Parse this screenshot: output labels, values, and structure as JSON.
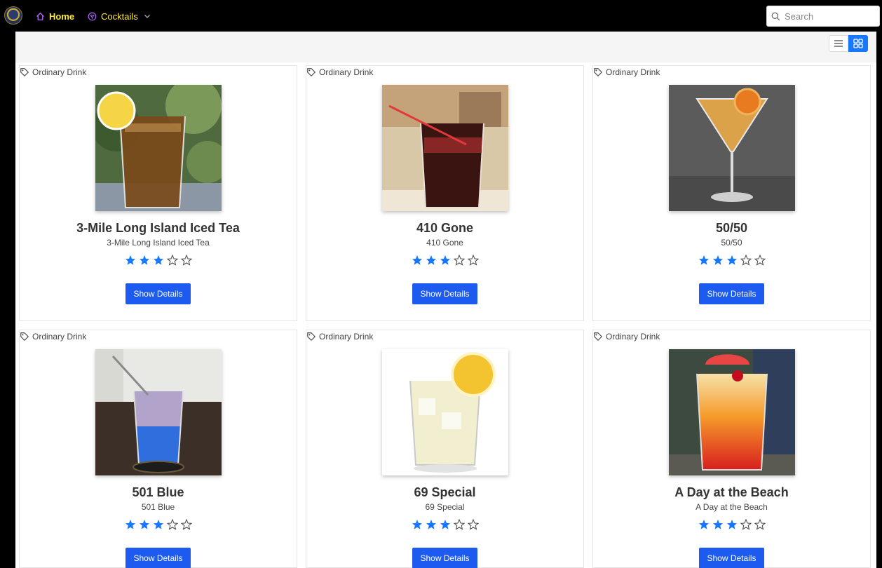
{
  "nav": {
    "home_label": "Home",
    "cocktails_label": "Cocktails",
    "search_placeholder": "Search",
    "accent_color": "#ffeb3b"
  },
  "view_toggle": {
    "active": "grid",
    "active_color": "#1677ff"
  },
  "cards": [
    {
      "tag": "Ordinary Drink",
      "title": "3-Mile Long Island Iced Tea",
      "subtitle": "3-Mile Long Island Iced Tea",
      "rating": 3,
      "max_rating": 5,
      "button": "Show Details",
      "image": "iced-tea-glass-with-lemon"
    },
    {
      "tag": "Ordinary Drink",
      "title": "410 Gone",
      "subtitle": "410 Gone",
      "rating": 3,
      "max_rating": 5,
      "button": "Show Details",
      "image": "dark-red-drink-with-straw"
    },
    {
      "tag": "Ordinary Drink",
      "title": "50/50",
      "subtitle": "50/50",
      "rating": 3,
      "max_rating": 5,
      "button": "Show Details",
      "image": "martini-glass-with-orange"
    },
    {
      "tag": "Ordinary Drink",
      "title": "501 Blue",
      "subtitle": "501 Blue",
      "rating": 3,
      "max_rating": 5,
      "button": "Show Details",
      "image": "blue-layered-drink-with-straw"
    },
    {
      "tag": "Ordinary Drink",
      "title": "69 Special",
      "subtitle": "69 Special",
      "rating": 3,
      "max_rating": 5,
      "button": "Show Details",
      "image": "clear-drink-with-lemon"
    },
    {
      "tag": "Ordinary Drink",
      "title": "A Day at the Beach",
      "subtitle": "A Day at the Beach",
      "rating": 3,
      "max_rating": 5,
      "button": "Show Details",
      "image": "sunrise-drink-with-grapefruit"
    }
  ]
}
